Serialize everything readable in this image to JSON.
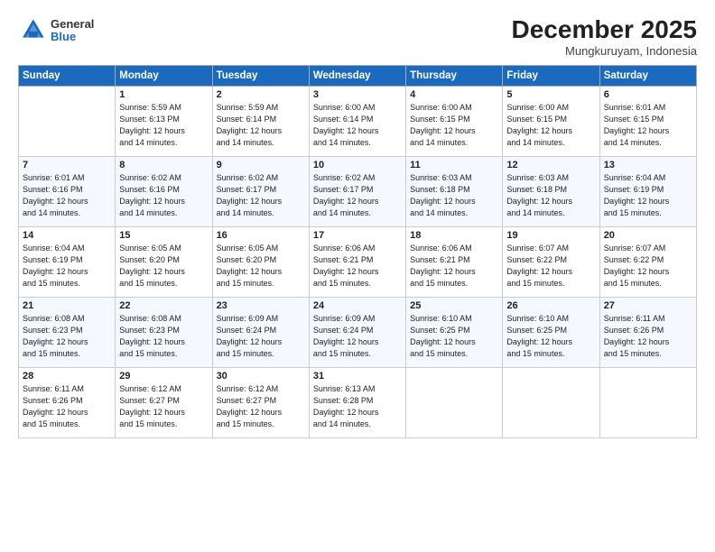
{
  "logo": {
    "general": "General",
    "blue": "Blue"
  },
  "title": "December 2025",
  "location": "Mungkuruyam, Indonesia",
  "days_header": [
    "Sunday",
    "Monday",
    "Tuesday",
    "Wednesday",
    "Thursday",
    "Friday",
    "Saturday"
  ],
  "weeks": [
    [
      {
        "day": "",
        "info": ""
      },
      {
        "day": "1",
        "info": "Sunrise: 5:59 AM\nSunset: 6:13 PM\nDaylight: 12 hours\nand 14 minutes."
      },
      {
        "day": "2",
        "info": "Sunrise: 5:59 AM\nSunset: 6:14 PM\nDaylight: 12 hours\nand 14 minutes."
      },
      {
        "day": "3",
        "info": "Sunrise: 6:00 AM\nSunset: 6:14 PM\nDaylight: 12 hours\nand 14 minutes."
      },
      {
        "day": "4",
        "info": "Sunrise: 6:00 AM\nSunset: 6:15 PM\nDaylight: 12 hours\nand 14 minutes."
      },
      {
        "day": "5",
        "info": "Sunrise: 6:00 AM\nSunset: 6:15 PM\nDaylight: 12 hours\nand 14 minutes."
      },
      {
        "day": "6",
        "info": "Sunrise: 6:01 AM\nSunset: 6:15 PM\nDaylight: 12 hours\nand 14 minutes."
      }
    ],
    [
      {
        "day": "7",
        "info": "Sunrise: 6:01 AM\nSunset: 6:16 PM\nDaylight: 12 hours\nand 14 minutes."
      },
      {
        "day": "8",
        "info": "Sunrise: 6:02 AM\nSunset: 6:16 PM\nDaylight: 12 hours\nand 14 minutes."
      },
      {
        "day": "9",
        "info": "Sunrise: 6:02 AM\nSunset: 6:17 PM\nDaylight: 12 hours\nand 14 minutes."
      },
      {
        "day": "10",
        "info": "Sunrise: 6:02 AM\nSunset: 6:17 PM\nDaylight: 12 hours\nand 14 minutes."
      },
      {
        "day": "11",
        "info": "Sunrise: 6:03 AM\nSunset: 6:18 PM\nDaylight: 12 hours\nand 14 minutes."
      },
      {
        "day": "12",
        "info": "Sunrise: 6:03 AM\nSunset: 6:18 PM\nDaylight: 12 hours\nand 14 minutes."
      },
      {
        "day": "13",
        "info": "Sunrise: 6:04 AM\nSunset: 6:19 PM\nDaylight: 12 hours\nand 15 minutes."
      }
    ],
    [
      {
        "day": "14",
        "info": "Sunrise: 6:04 AM\nSunset: 6:19 PM\nDaylight: 12 hours\nand 15 minutes."
      },
      {
        "day": "15",
        "info": "Sunrise: 6:05 AM\nSunset: 6:20 PM\nDaylight: 12 hours\nand 15 minutes."
      },
      {
        "day": "16",
        "info": "Sunrise: 6:05 AM\nSunset: 6:20 PM\nDaylight: 12 hours\nand 15 minutes."
      },
      {
        "day": "17",
        "info": "Sunrise: 6:06 AM\nSunset: 6:21 PM\nDaylight: 12 hours\nand 15 minutes."
      },
      {
        "day": "18",
        "info": "Sunrise: 6:06 AM\nSunset: 6:21 PM\nDaylight: 12 hours\nand 15 minutes."
      },
      {
        "day": "19",
        "info": "Sunrise: 6:07 AM\nSunset: 6:22 PM\nDaylight: 12 hours\nand 15 minutes."
      },
      {
        "day": "20",
        "info": "Sunrise: 6:07 AM\nSunset: 6:22 PM\nDaylight: 12 hours\nand 15 minutes."
      }
    ],
    [
      {
        "day": "21",
        "info": "Sunrise: 6:08 AM\nSunset: 6:23 PM\nDaylight: 12 hours\nand 15 minutes."
      },
      {
        "day": "22",
        "info": "Sunrise: 6:08 AM\nSunset: 6:23 PM\nDaylight: 12 hours\nand 15 minutes."
      },
      {
        "day": "23",
        "info": "Sunrise: 6:09 AM\nSunset: 6:24 PM\nDaylight: 12 hours\nand 15 minutes."
      },
      {
        "day": "24",
        "info": "Sunrise: 6:09 AM\nSunset: 6:24 PM\nDaylight: 12 hours\nand 15 minutes."
      },
      {
        "day": "25",
        "info": "Sunrise: 6:10 AM\nSunset: 6:25 PM\nDaylight: 12 hours\nand 15 minutes."
      },
      {
        "day": "26",
        "info": "Sunrise: 6:10 AM\nSunset: 6:25 PM\nDaylight: 12 hours\nand 15 minutes."
      },
      {
        "day": "27",
        "info": "Sunrise: 6:11 AM\nSunset: 6:26 PM\nDaylight: 12 hours\nand 15 minutes."
      }
    ],
    [
      {
        "day": "28",
        "info": "Sunrise: 6:11 AM\nSunset: 6:26 PM\nDaylight: 12 hours\nand 15 minutes."
      },
      {
        "day": "29",
        "info": "Sunrise: 6:12 AM\nSunset: 6:27 PM\nDaylight: 12 hours\nand 15 minutes."
      },
      {
        "day": "30",
        "info": "Sunrise: 6:12 AM\nSunset: 6:27 PM\nDaylight: 12 hours\nand 15 minutes."
      },
      {
        "day": "31",
        "info": "Sunrise: 6:13 AM\nSunset: 6:28 PM\nDaylight: 12 hours\nand 14 minutes."
      },
      {
        "day": "",
        "info": ""
      },
      {
        "day": "",
        "info": ""
      },
      {
        "day": "",
        "info": ""
      }
    ]
  ]
}
